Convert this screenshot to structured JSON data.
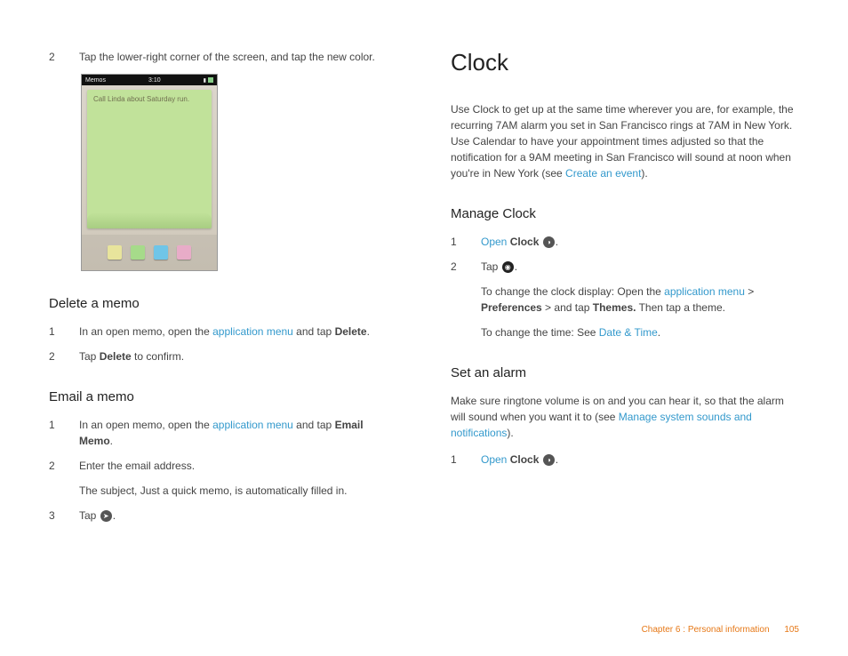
{
  "left": {
    "step2": {
      "num": "2",
      "text": "Tap the lower-right corner of the screen, and tap the new color."
    },
    "phone": {
      "app": "Memos",
      "time": "3:10",
      "note": "Call Linda about Saturday run."
    },
    "deleteHeading": "Delete a memo",
    "del1": {
      "num": "1",
      "pre": "In an open memo, open the ",
      "link": "application menu",
      "post": " and tap ",
      "bold": "Delete",
      "end": "."
    },
    "del2": {
      "num": "2",
      "pre": "Tap ",
      "bold": "Delete",
      "post": " to confirm."
    },
    "emailHeading": "Email a memo",
    "em1": {
      "num": "1",
      "pre": "In an open memo, open the ",
      "link": "application menu",
      "post": " and tap ",
      "bold": "Email Memo",
      "end": "."
    },
    "em2": {
      "num": "2",
      "text": "Enter the email address."
    },
    "em2sub": "The subject, Just a quick memo, is automatically filled in.",
    "em3": {
      "num": "3",
      "text": "Tap ",
      "glyph": "➤",
      "end": "."
    }
  },
  "right": {
    "heading": "Clock",
    "intro": {
      "pre": "Use Clock to get up at the same time wherever you are, for example, the recurring 7AM alarm you set in San Francisco rings at 7AM in New York. Use Calendar to have your appointment times adjusted so that the notification for a 9AM meeting in San Francisco will sound at noon when you're in New York (see ",
      "link": "Create an event",
      "post": ")."
    },
    "manageHeading": "Manage Clock",
    "m1": {
      "num": "1",
      "link": "Open",
      "bold": "Clock",
      "glyph": "◑",
      "end": "."
    },
    "m2": {
      "num": "2",
      "pre": "Tap ",
      "glyph": "◉",
      "end": "."
    },
    "m2suba": {
      "pre": "To change the clock display: Open the ",
      "link": "application menu",
      "gt": " > ",
      "bold1": "Preferences",
      "mid": " > and tap ",
      "bold2": "Themes.",
      "post": " Then tap a theme."
    },
    "m2subb": {
      "pre": "To change the time: See ",
      "link": "Date & Time",
      "end": "."
    },
    "alarmHeading": "Set an alarm",
    "alarmIntro": {
      "pre": "Make sure ringtone volume is on and you can hear it, so that the alarm will sound when you want it to (see ",
      "link": "Manage system sounds and notifications",
      "post": ")."
    },
    "a1": {
      "num": "1",
      "link": "Open",
      "bold": "Clock",
      "glyph": "◑",
      "end": "."
    }
  },
  "footer": {
    "chapter": "Chapter 6 : Personal information",
    "page": "105"
  }
}
